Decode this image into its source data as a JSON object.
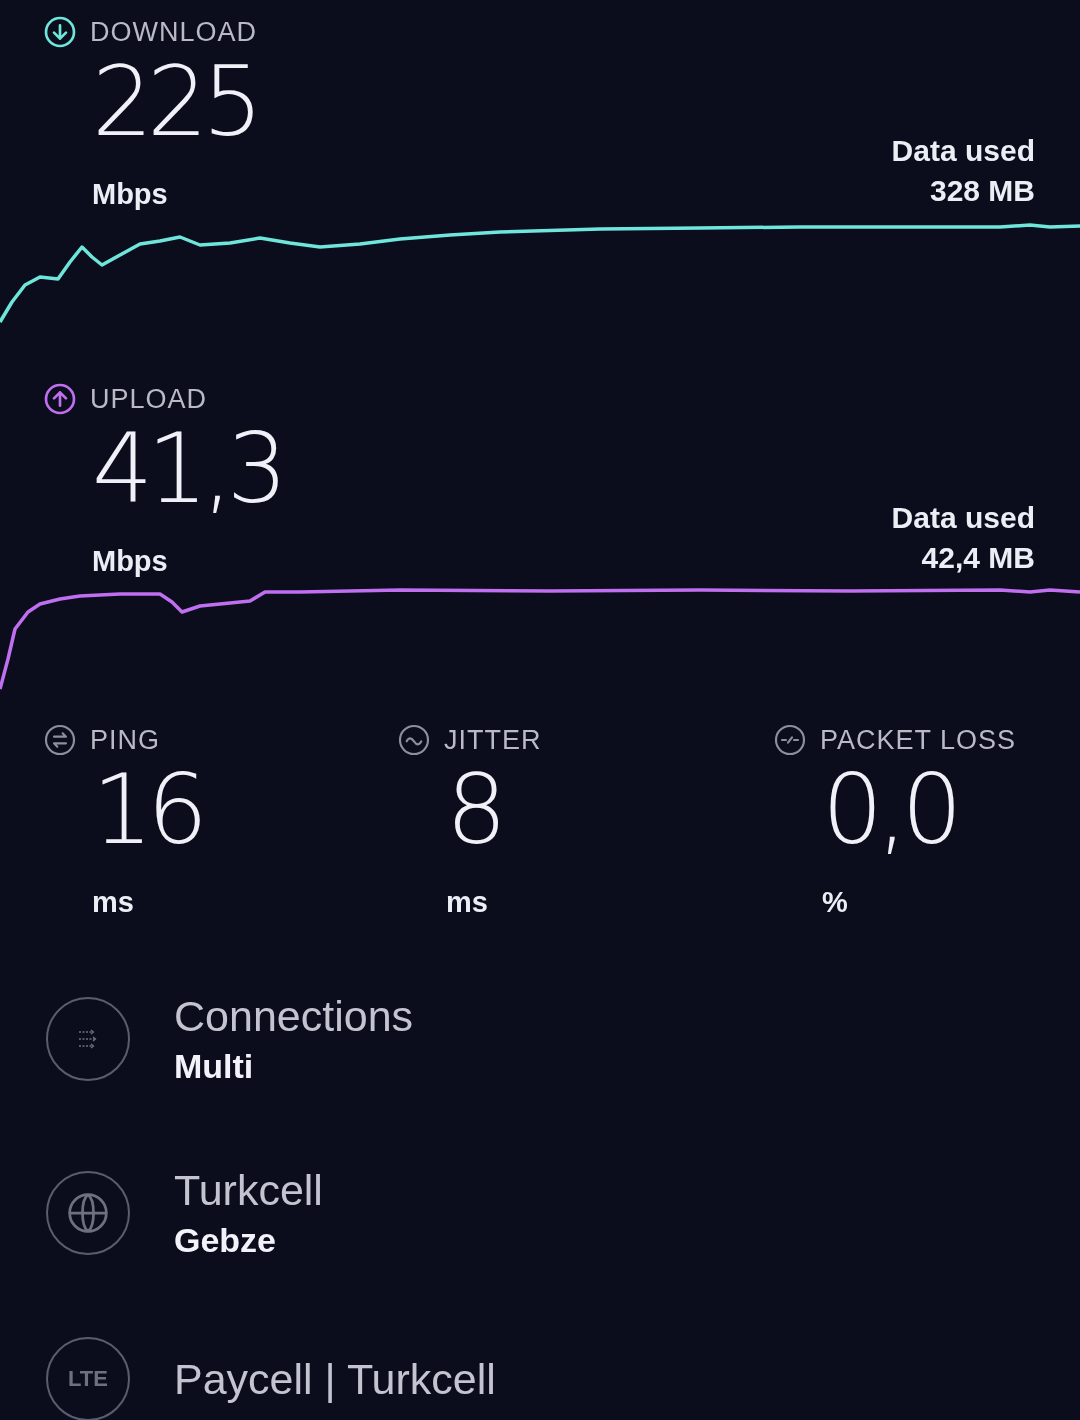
{
  "speeds": [
    {
      "kind": "download",
      "label": "DOWNLOAD",
      "value": "225",
      "unit": "Mbps",
      "data_label": "Data used",
      "data_value": "328 MB"
    },
    {
      "kind": "upload",
      "label": "UPLOAD",
      "value": "41,3",
      "unit": "Mbps",
      "data_label": "Data used",
      "data_value": "42,4 MB"
    }
  ],
  "metrics": [
    {
      "kind": "ping",
      "label": "PING",
      "value": "16",
      "unit": "ms"
    },
    {
      "kind": "jitter",
      "label": "JITTER",
      "value": "8",
      "unit": "ms"
    },
    {
      "kind": "packet_loss",
      "label": "PACKET LOSS",
      "value": "0,0",
      "unit": "%"
    }
  ],
  "details": [
    {
      "kind": "connections",
      "title": "Connections",
      "value": "Multi"
    },
    {
      "kind": "server",
      "title": "Turkcell",
      "value": "Gebze"
    },
    {
      "kind": "provider",
      "badge": "LTE",
      "title": "Paycell | Turkcell"
    }
  ]
}
